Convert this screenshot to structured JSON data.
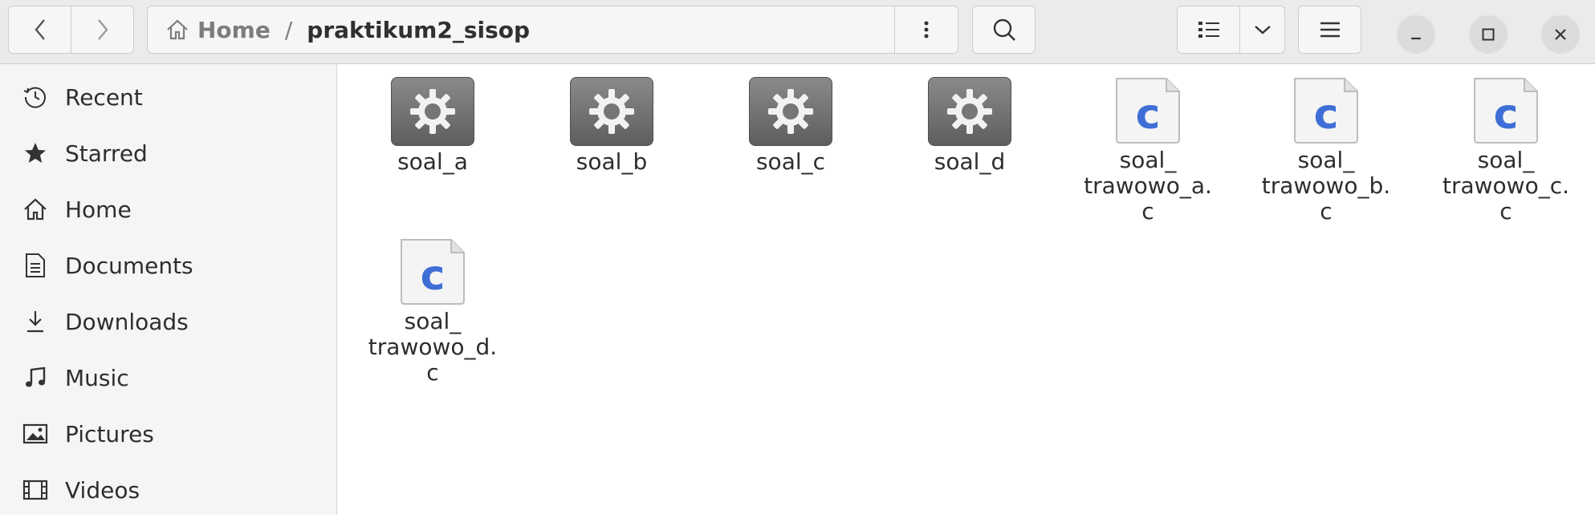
{
  "header": {
    "breadcrumb": {
      "home_label": "Home",
      "separator": "/",
      "current": "praktikum2_sisop"
    }
  },
  "sidebar": {
    "items": [
      {
        "label": "Recent",
        "icon": "clock-icon"
      },
      {
        "label": "Starred",
        "icon": "star-icon"
      },
      {
        "label": "Home",
        "icon": "home-icon"
      },
      {
        "label": "Documents",
        "icon": "document-icon"
      },
      {
        "label": "Downloads",
        "icon": "download-icon"
      },
      {
        "label": "Music",
        "icon": "music-note-icon"
      },
      {
        "label": "Pictures",
        "icon": "picture-icon"
      },
      {
        "label": "Videos",
        "icon": "film-icon"
      }
    ]
  },
  "files": [
    {
      "name": "soal_a",
      "type": "executable"
    },
    {
      "name": "soal_b",
      "type": "executable"
    },
    {
      "name": "soal_c",
      "type": "executable"
    },
    {
      "name": "soal_d",
      "type": "executable"
    },
    {
      "name": "soal_\ntrawowo_a.\nc",
      "type": "c-source"
    },
    {
      "name": "soal_\ntrawowo_b.\nc",
      "type": "c-source"
    },
    {
      "name": "soal_\ntrawowo_c.\nc",
      "type": "c-source"
    },
    {
      "name": "soal_\ntrawowo_d.\nc",
      "type": "c-source"
    }
  ],
  "colors": {
    "c_letter": "#3f6fd6",
    "header_bg": "#ebebeb",
    "sidebar_bg": "#f5f5f5"
  }
}
